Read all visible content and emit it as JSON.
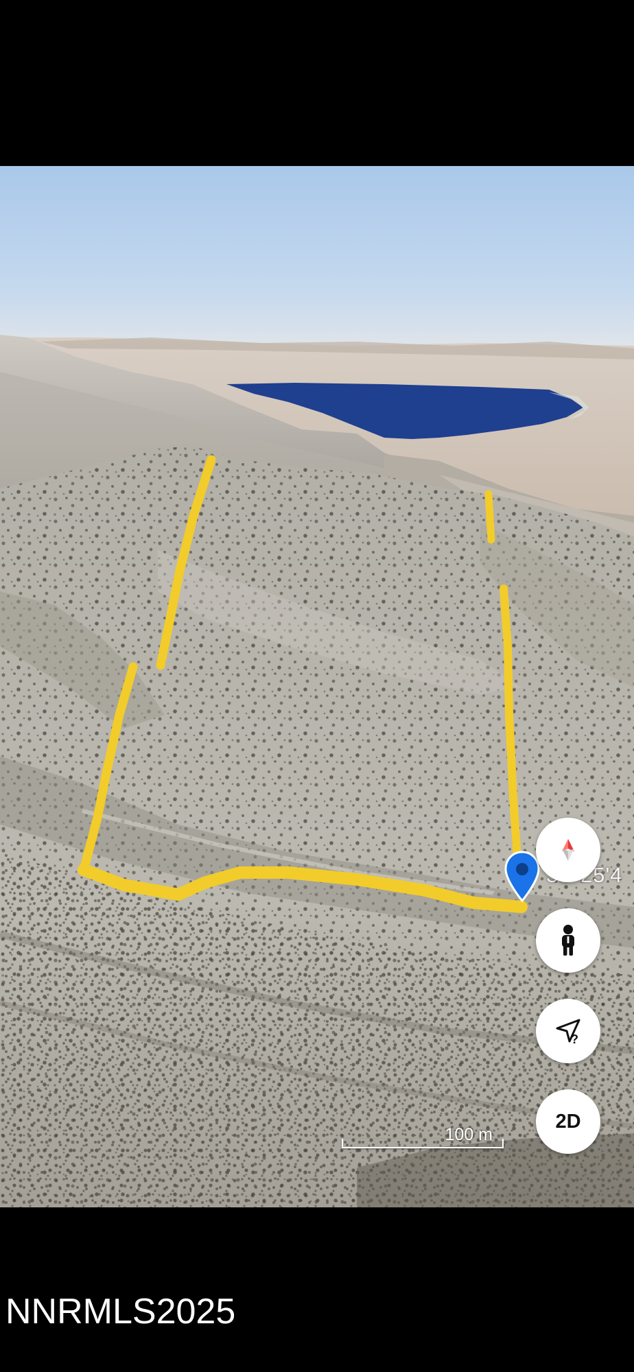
{
  "map": {
    "coordinate_readout": "38°25'4",
    "scale_label": "100 m",
    "parcel_outline_color": "#f2cc2a",
    "pin_color": "#1a73e8",
    "water_color": "#1f3f8f"
  },
  "controls": {
    "compass_icon": "compass-icon",
    "street_view_icon": "pegman-icon",
    "help_icon": "navigate-help-icon",
    "view_toggle_label": "2D"
  },
  "watermark": {
    "text": "NNRMLS2025"
  }
}
